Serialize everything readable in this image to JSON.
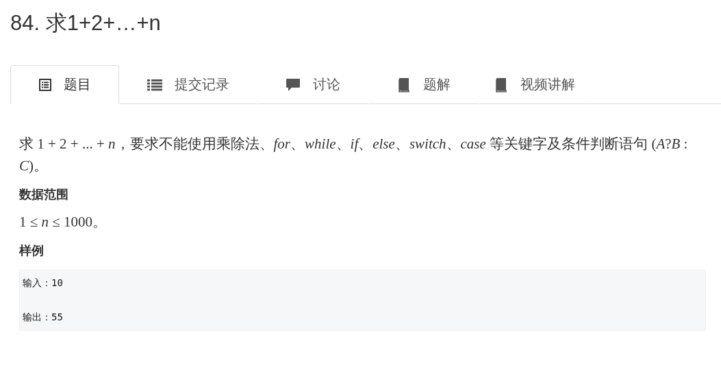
{
  "title": "84. 求1+2+…+n",
  "tabs": [
    {
      "label": "题目",
      "kind": "document",
      "selected": true
    },
    {
      "label": "提交记录",
      "kind": "list",
      "selected": false
    },
    {
      "label": "讨论",
      "kind": "comment",
      "selected": false
    },
    {
      "label": "题解",
      "kind": "book",
      "selected": false
    },
    {
      "label": "视频讲解",
      "kind": "book",
      "selected": false
    }
  ],
  "description": "求 1 + 2 + ... + *n*，要求不能使用乘除法、*for*、*while*、*if*、*else*、*switch*、*case* 等关键字及条件判断语句 (*A*?*B* : *C*)。",
  "sections": [
    {
      "heading": "数据范围",
      "text": "1 ≤ *n* ≤ 1000。"
    }
  ],
  "sample": {
    "heading": "样例",
    "lines": [
      "输入：10",
      "输出：55"
    ]
  }
}
